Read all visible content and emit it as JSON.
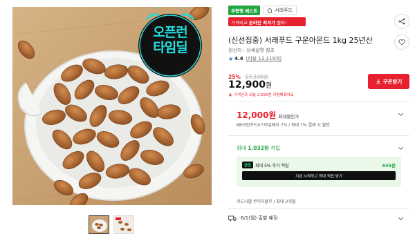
{
  "hero": {
    "promo_line1": "오픈런",
    "promo_line2": "타임딜"
  },
  "thumbnails": [
    {
      "name": "thumbnail-1",
      "active": true
    },
    {
      "name": "thumbnail-2",
      "active": false
    }
  ],
  "badges": {
    "best": "쿠팡랭 베스트",
    "store": "서래푸드"
  },
  "compare_banner": {
    "prefix": "가격비교 ",
    "highlight": "온라인 최저가",
    "suffix": " 빨라!"
  },
  "product": {
    "title": "(신선집중) 서래푸드 구운아몬드 1kg 25년산",
    "origin": "원산지 : 상세설명 참조",
    "rating": "4.4",
    "review_count": "(리뷰 12,119개)"
  },
  "pricing": {
    "discount_pct": "25%",
    "original_price": "17,330원",
    "price": "12,900",
    "price_unit": "원",
    "note": "가격인하 오늘 2,590원 저렴해졌어요",
    "coupon_label": "쿠폰받기"
  },
  "best_price": {
    "amount": "12,000원",
    "label": "최대할인가",
    "detail": "KB국민카드X스마일페이 7% / 최대 7% 결제 시 할인"
  },
  "points": {
    "prefix": "최대 ",
    "amount": "1,032원",
    "suffix": " 적립",
    "tag": "클럽",
    "tag_text": "최대 5% 추가 적립",
    "extra_amount": "645원",
    "cta": "지금 시작하고 최대 적립 받기"
  },
  "card": {
    "info": "카드사별 무이자할부 / 최대 3개월"
  },
  "shipping": {
    "text": "6/1(월) 출발 예정"
  },
  "colors": {
    "accent_red": "#e6202e",
    "accent_green": "#21a541",
    "star_blue": "#1a73e8"
  }
}
